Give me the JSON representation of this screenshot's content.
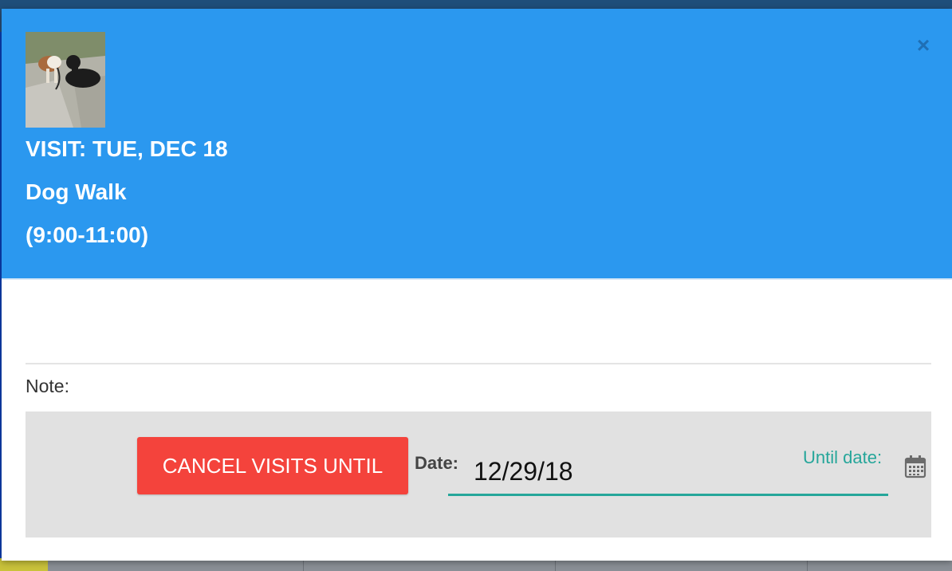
{
  "header": {
    "visit_title": "VISIT: TUE, DEC 18",
    "service": "Dog Walk",
    "time_window": "(9:00-11:00)",
    "photo_icon": "pet-photo",
    "close_icon": "close-icon",
    "close_glyph": "×"
  },
  "note": {
    "label": "Note:"
  },
  "cancel": {
    "button_label": "CANCEL VISITS UNTIL",
    "date_label": "Date:",
    "date_value": "12/29/18",
    "until_label": "Until date:",
    "calendar_icon": "calendar-icon"
  },
  "colors": {
    "header_bg": "#2b98ef",
    "cancel_button": "#f4433c",
    "accent": "#26a69a",
    "panel_bg": "#e1e1e1"
  }
}
